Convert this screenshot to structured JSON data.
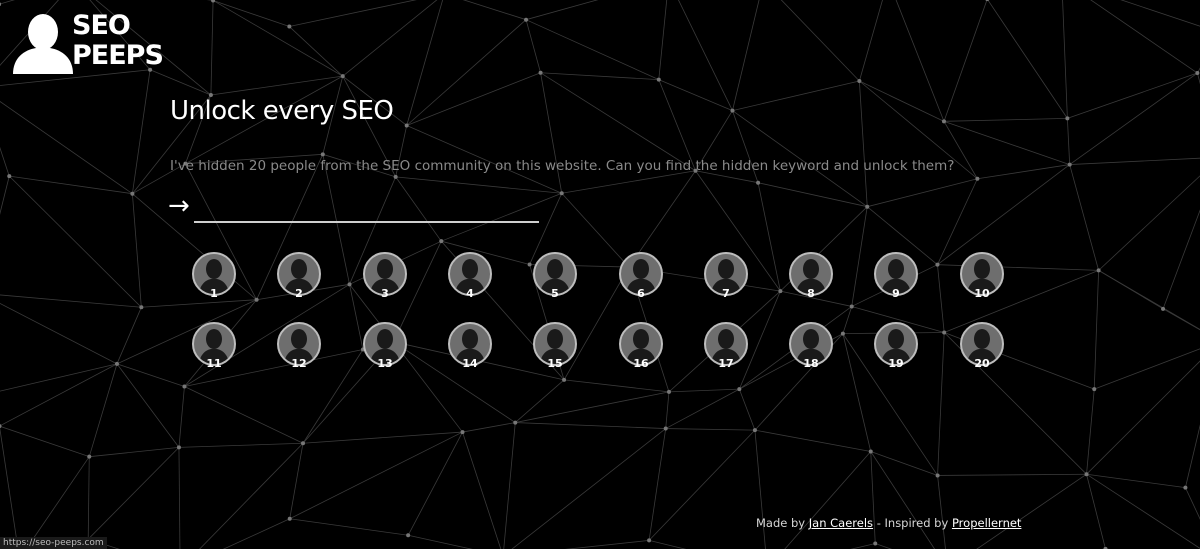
{
  "brand": {
    "line1": "SEO",
    "line2": "PEEPS",
    "icon": "person-silhouette-icon"
  },
  "main": {
    "title": "Unlock every SEO",
    "intro": "I've hidden 20 people from the SEO community on this website. Can you find the hidden keyword and unlock them?",
    "arrow": "→",
    "keyword_value": ""
  },
  "peeps": [
    {
      "number": "1"
    },
    {
      "number": "2"
    },
    {
      "number": "3"
    },
    {
      "number": "4"
    },
    {
      "number": "5"
    },
    {
      "number": "6"
    },
    {
      "number": "7"
    },
    {
      "number": "8"
    },
    {
      "number": "9"
    },
    {
      "number": "10"
    },
    {
      "number": "11"
    },
    {
      "number": "12"
    },
    {
      "number": "13"
    },
    {
      "number": "14"
    },
    {
      "number": "15"
    },
    {
      "number": "16"
    },
    {
      "number": "17"
    },
    {
      "number": "18"
    },
    {
      "number": "19"
    },
    {
      "number": "20"
    }
  ],
  "footer": {
    "made_by": "Made by",
    "author": "Jan Caerels",
    "separator": " - Inspired by ",
    "inspired_by": "Propellernet"
  },
  "status_bar": {
    "url": "https://seo-peeps.com"
  },
  "colors": {
    "background": "#000000",
    "network_lines": "#3a3a3a",
    "network_nodes": "#777777",
    "avatar_fill": "#6e6e6e",
    "avatar_border": "#bdbdbd",
    "intro_text": "#8a8a8a"
  }
}
